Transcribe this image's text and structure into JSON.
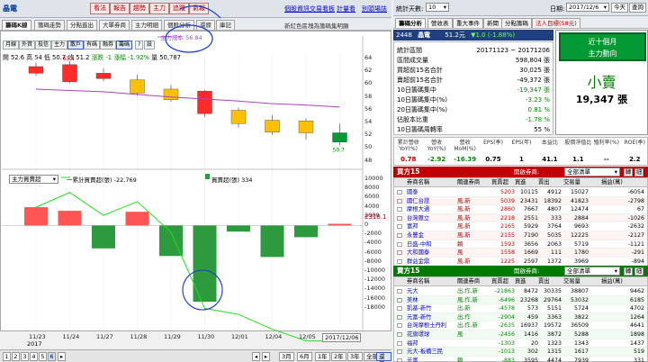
{
  "topbar": {
    "symbol": "晶電",
    "buttons": [
      "看法",
      "報告",
      "趨勢",
      "主力",
      "追蹤",
      "氣報"
    ],
    "links": [
      "個股資訊",
      "交易看板",
      "計量看",
      "別頭場誌"
    ]
  },
  "tabs": [
    "籌碼K線",
    "籌碼走勢",
    "分點進出",
    "大單券商",
    "主力明細",
    "個股分析",
    "還原",
    "庫記"
  ],
  "tab_note": "新紅色區塊為籌碼集明顯",
  "toolbar": [
    "月線",
    "外資",
    "投信",
    "主力",
    "散戶",
    "有碼",
    "融券",
    "籌碼",
    "?",
    "設"
  ],
  "ohlc": {
    "open": "開 52.6",
    "high": "高 54",
    "low": "低 50.7",
    "close": "收 51.2",
    "change": "漲跌 -1",
    "pct": "漲幅 -1.92%",
    "volume": "量 50,787"
  },
  "annotations": {
    "cost_label": "主力成本 56.84",
    "max_label": "63.4",
    "min_label": "50.7",
    "last_vol": "2318.1"
  },
  "price_axis": [
    "64",
    "62",
    "60",
    "58",
    "56",
    "54",
    "52",
    "50",
    "48"
  ],
  "vol_axis": [
    "10000",
    "8000",
    "6000",
    "4000",
    "2000",
    "0",
    "-2000",
    "-4000",
    "-6000",
    "-8000",
    "-10000",
    "-12000",
    "-14000",
    "-16000",
    "-18000"
  ],
  "sub_legend": {
    "select": "主力買賣超",
    "cum_label": "一累計買賣超(張) -22,769",
    "net_label": "買賣超(張) 334"
  },
  "chart_data": [
    {
      "type": "candlestick",
      "categories": [
        "11/23",
        "11/24",
        "11/27",
        "11/28",
        "11/29",
        "11/30",
        "12/01",
        "12/04",
        "12/05",
        "12/06"
      ],
      "open": [
        61.6,
        62.9,
        61.6,
        60.6,
        59.2,
        58.9,
        56.0,
        54.5,
        54.4,
        52.6
      ],
      "close": [
        62.6,
        60.3,
        60.8,
        58.6,
        57.6,
        55.5,
        54.0,
        52.7,
        52.6,
        51.2
      ],
      "high": [
        63.2,
        63.4,
        62.3,
        61.4,
        59.8,
        59.1,
        56.4,
        55.3,
        54.8,
        54.0
      ],
      "low": [
        61.2,
        60.1,
        60.4,
        58.2,
        57.3,
        55.0,
        53.4,
        52.3,
        51.6,
        50.7
      ],
      "colors": [
        "red",
        "red",
        "red",
        "yellow",
        "yellow",
        "red",
        "yellow",
        "yellow",
        "yellow",
        "green"
      ],
      "ma": [
        59.2,
        59.0,
        58.8,
        58.4,
        58.0,
        57.7,
        57.4,
        57.0,
        56.8,
        56.5
      ],
      "ylim": [
        47.5,
        64.5
      ],
      "xlabel_year": "2017",
      "x_current": "2017/12/06"
    },
    {
      "type": "bar",
      "categories": [
        "11/23",
        "11/24",
        "11/27",
        "11/28",
        "11/29",
        "11/30",
        "12/01",
        "12/04",
        "12/05",
        "12/06"
      ],
      "values": [
        3600,
        2900,
        -4500,
        2700,
        -6000,
        -15000,
        -1200,
        -6200,
        -2300,
        334
      ],
      "cumulative": [
        3600,
        6500,
        2000,
        4700,
        -1300,
        -16300,
        -17500,
        -20400,
        -22700,
        -22769
      ],
      "ylim": [
        -18000,
        10000
      ]
    }
  ],
  "right": {
    "stat_period_label": "統計天數:",
    "stat_period_value": "10",
    "date_label": "日期:",
    "date_value": "2017/12/6",
    "today_btn": "今天",
    "query_btn": "查詢",
    "tabs": [
      "籌碼分析",
      "營收表",
      "重大事件",
      "新聞",
      "分點籌碼",
      "法人目標(58元)"
    ],
    "stock_code": "2448",
    "stock_name": "晶電",
    "stock_price": "51.2元",
    "stock_change": "▼1.0 (-1.88%)",
    "info_rows": [
      {
        "label": "統計區間",
        "value": "20171123 ~ 20171206"
      },
      {
        "label": "區間成交量",
        "value": "598,804 張"
      },
      {
        "label": "買超前15名合計",
        "value": "30,025 張"
      },
      {
        "label": "賣超前15名合計",
        "value": "-49,372 張"
      },
      {
        "label": "10日籌碼集中",
        "value": "-19,347 張"
      },
      {
        "label": "10日籌碼集中(%)",
        "value": "-3.23 %"
      },
      {
        "label": "20日籌碼集中(%)",
        "value": "0.81 %"
      },
      {
        "label": "佔股本比重",
        "value": "-1.78 %"
      },
      {
        "label": "10日籌碼周轉率",
        "value": "55 %"
      }
    ],
    "big_box": {
      "title": "近十個月",
      "subtitle": "主力動向",
      "status": "小賣",
      "amount": "19,347 張"
    },
    "fin_headers": [
      "累計營收YoY(%)",
      "營收YoY(%)",
      "營收MoM(%)",
      "EPS(季)",
      "EPS(年)",
      "本益比",
      "股價淨值比",
      "殖利率(%)",
      "ROE(季)"
    ],
    "fin_values": [
      "0.78",
      "-2.92",
      "-16.39",
      "0.75",
      "1",
      "41.1",
      "1.1",
      "--",
      "2.2"
    ],
    "buy_section": {
      "title": "買方15",
      "hint": "開啟券商:",
      "select": "全部清單",
      "btns": [
        "轉",
        "細"
      ]
    },
    "sell_section": {
      "title": "賣方15",
      "hint": "開啟券商:",
      "select": "全部清單",
      "btns": [
        "轉",
        "細"
      ]
    },
    "table_headers": [
      "券商名稱",
      "關連券商",
      "買賣超",
      "買進",
      "賣出",
      "交易量",
      "損益(萬)"
    ],
    "buy_rows": [
      {
        "name": "國泰",
        "rel": "",
        "net": "5203",
        "buy": "10115",
        "sell": "4912",
        "vol": "15027",
        "pnl": "-6054"
      },
      {
        "name": "國仁台證",
        "rel": "風,新",
        "net": "5039",
        "buy": "23431",
        "sell": "18392",
        "vol": "41823",
        "pnl": "-2798"
      },
      {
        "name": "摩根大通",
        "rel": "風,新",
        "net": "2860",
        "buy": "7667",
        "sell": "4807",
        "vol": "12474",
        "pnl": "67"
      },
      {
        "name": "台灣匯立",
        "rel": "風,新",
        "net": "2218",
        "buy": "2551",
        "sell": "333",
        "vol": "2884",
        "pnl": "-1026"
      },
      {
        "name": "富邦",
        "rel": "風,新",
        "net": "2165",
        "buy": "5929",
        "sell": "3764",
        "vol": "9693",
        "pnl": "-2632"
      },
      {
        "name": "永豐金",
        "rel": "風,新",
        "net": "2155",
        "buy": "7190",
        "sell": "5035",
        "vol": "12225",
        "pnl": "-2127"
      },
      {
        "name": "日盛-中和",
        "rel": "賴",
        "net": "1593",
        "buy": "3656",
        "sell": "2063",
        "vol": "5719",
        "pnl": "-1121"
      },
      {
        "name": "大和國泰",
        "rel": "風",
        "net": "1558",
        "buy": "1669",
        "sell": "111",
        "vol": "1780",
        "pnl": "-291"
      },
      {
        "name": "群益金鼎",
        "rel": "風,新",
        "net": "1225",
        "buy": "2597",
        "sell": "1372",
        "vol": "3969",
        "pnl": "-894"
      }
    ],
    "sell_rows": [
      {
        "name": "元大",
        "rel": "出,作,新",
        "net": "-21863",
        "buy": "8472",
        "sell": "30335",
        "vol": "38807",
        "pnl": "9462"
      },
      {
        "name": "美林",
        "rel": "風,作,新",
        "net": "-6496",
        "buy": "23268",
        "sell": "29764",
        "vol": "53032",
        "pnl": "6185"
      },
      {
        "name": "凱基-新竹",
        "rel": "出,新",
        "net": "-4578",
        "buy": "573",
        "sell": "5151",
        "vol": "5724",
        "pnl": "4702"
      },
      {
        "name": "元富-新竹",
        "rel": "出,作",
        "net": "-2904",
        "buy": "459",
        "sell": "3363",
        "vol": "3822",
        "pnl": "1264"
      },
      {
        "name": "台灣摩根士丹利",
        "rel": "出,作,新",
        "net": "-2635",
        "buy": "16937",
        "sell": "19572",
        "vol": "36509",
        "pnl": "4641"
      },
      {
        "name": "花旗環球",
        "rel": "風",
        "net": "-2456",
        "buy": "1416",
        "sell": "3872",
        "vol": "5288",
        "pnl": "1898"
      },
      {
        "name": "福邦",
        "rel": "",
        "net": "-1303",
        "buy": "20",
        "sell": "1323",
        "vol": "1343",
        "pnl": "1437"
      },
      {
        "name": "元大-板橋三民",
        "rel": "",
        "net": "-1013",
        "buy": "302",
        "sell": "1315",
        "vol": "1617",
        "pnl": "519"
      },
      {
        "name": "元富",
        "rel": "賴",
        "net": "-883",
        "buy": "3595",
        "sell": "4474",
        "vol": "7939",
        "pnl": "331"
      }
    ]
  },
  "bottom": {
    "pages": [
      "1",
      "2",
      "3",
      "4",
      "5",
      "6"
    ],
    "zoom": [
      "3月",
      "6月",
      "1年",
      "2年",
      "3年",
      "全部",
      "還原"
    ]
  }
}
